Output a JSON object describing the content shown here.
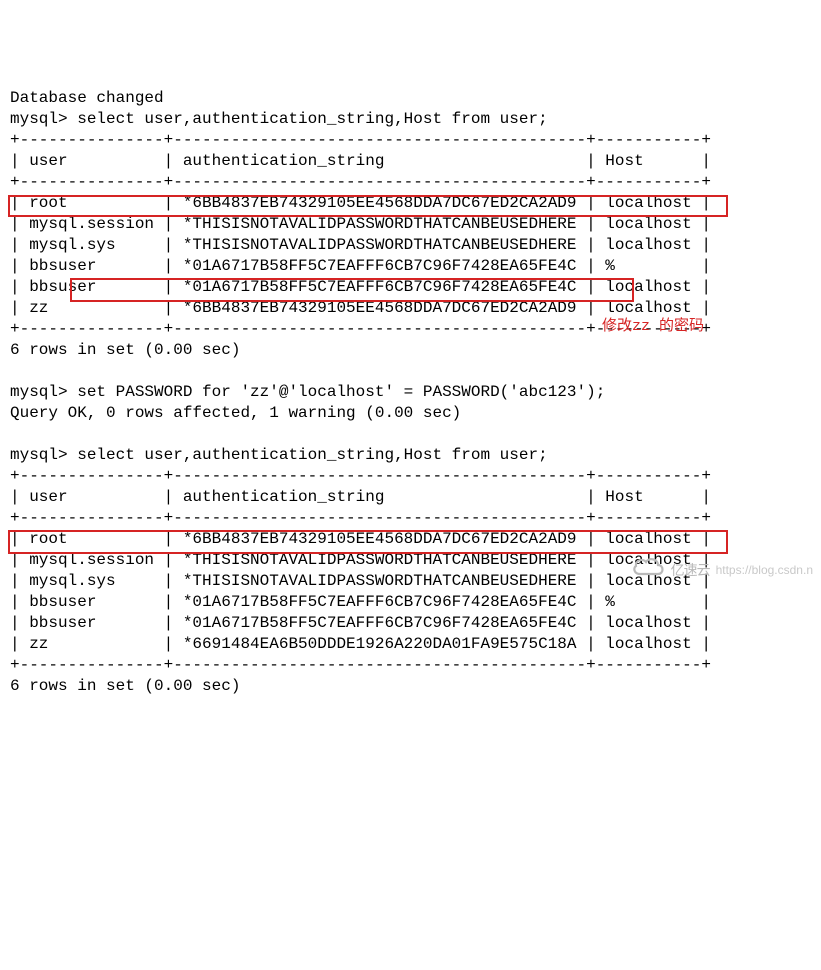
{
  "pre_line": "Database changed",
  "prompt": "mysql>",
  "query1": "select user,authentication_string,Host from user;",
  "border_main": "+---------------+-------------------------------------------+-----------+",
  "header": {
    "user": "| user          | ",
    "auth": "authentication_string                     | ",
    "host": "Host      |"
  },
  "table1": {
    "rows": [
      {
        "user": "root",
        "auth": "*6BB4837EB74329105EE4568DDA7DC67ED2CA2AD9",
        "host": "localhost"
      },
      {
        "user": "mysql.session",
        "auth": "*THISISNOTAVALIDPASSWORDTHATCANBEUSEDHERE",
        "host": "localhost"
      },
      {
        "user": "mysql.sys",
        "auth": "*THISISNOTAVALIDPASSWORDTHATCANBEUSEDHERE",
        "host": "localhost"
      },
      {
        "user": "bbsuser",
        "auth": "*01A6717B58FF5C7EAFFF6CB7C96F7428EA65FE4C",
        "host": "%"
      },
      {
        "user": "bbsuser",
        "auth": "*01A6717B58FF5C7EAFFF6CB7C96F7428EA65FE4C",
        "host": "localhost"
      },
      {
        "user": "zz",
        "auth": "*6BB4837EB74329105EE4568DDA7DC67ED2CA2AD9",
        "host": "localhost"
      }
    ]
  },
  "footer1": "6 rows in set (0.00 sec)",
  "set_password_cmd": "set PASSWORD for 'zz'@'localhost' = PASSWORD('abc123');",
  "set_password_result": "Query OK, 0 rows affected, 1 warning (0.00 sec)",
  "annotation_text": "修改zz 的密码",
  "query2": "select user,authentication_string,Host from user;",
  "table2": {
    "rows": [
      {
        "user": "root",
        "auth": "*6BB4837EB74329105EE4568DDA7DC67ED2CA2AD9",
        "host": "localhost"
      },
      {
        "user": "mysql.session",
        "auth": "*THISISNOTAVALIDPASSWORDTHATCANBEUSEDHERE",
        "host": "localhost"
      },
      {
        "user": "mysql.sys",
        "auth": "*THISISNOTAVALIDPASSWORDTHATCANBEUSEDHERE",
        "host": "localhost"
      },
      {
        "user": "bbsuser",
        "auth": "*01A6717B58FF5C7EAFFF6CB7C96F7428EA65FE4C",
        "host": "%"
      },
      {
        "user": "bbsuser",
        "auth": "*01A6717B58FF5C7EAFFF6CB7C96F7428EA65FE4C",
        "host": "localhost"
      },
      {
        "user": "zz",
        "auth": "*6691484EA6B50DDDE1926A220DA01FA9E575C18A",
        "host": "localhost"
      }
    ]
  },
  "footer2": "6 rows in set (0.00 sec)",
  "watermark": {
    "brand": "亿速云",
    "url": "https://blog.csdn.n"
  }
}
